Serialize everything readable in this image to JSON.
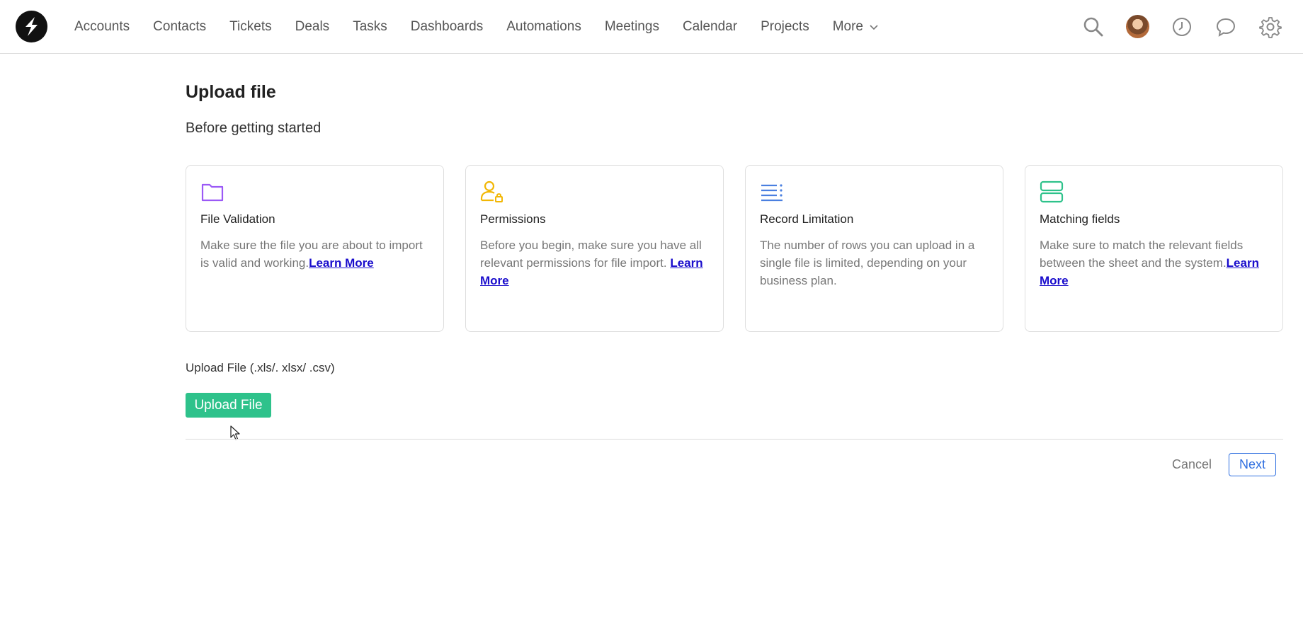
{
  "nav": {
    "items": [
      "Accounts",
      "Contacts",
      "Tickets",
      "Deals",
      "Tasks",
      "Dashboards",
      "Automations",
      "Meetings",
      "Calendar",
      "Projects"
    ],
    "more_label": "More"
  },
  "page": {
    "title": "Upload file",
    "subtitle": "Before getting started"
  },
  "cards": [
    {
      "icon": "folder-icon",
      "color": "#9b59f6",
      "title": "File Validation",
      "text": "Make sure the file you are about to import is valid and working.",
      "link": "Learn More"
    },
    {
      "icon": "user-lock-icon",
      "color": "#f2b705",
      "title": "Permissions",
      "text": "Before you begin, make sure you have all relevant permissions for file import. ",
      "link": "Learn More"
    },
    {
      "icon": "list-icon",
      "color": "#4a7fe0",
      "title": "Record Limitation",
      "text": "The number of rows you can upload in a single file is limited, depending on your business plan.",
      "link": ""
    },
    {
      "icon": "rows-icon",
      "color": "#2ec28b",
      "title": "Matching fields",
      "text": "Make sure to match the relevant fields between the sheet and the system.",
      "link": "Learn More"
    }
  ],
  "upload": {
    "label": "Upload File (.xls/. xlsx/ .csv)",
    "button_label": "Upload File",
    "button_color": "#2ec28b"
  },
  "footer": {
    "cancel_label": "Cancel",
    "next_label": "Next",
    "next_color": "#2f6fe0"
  },
  "link_color": "#1a0dcc"
}
